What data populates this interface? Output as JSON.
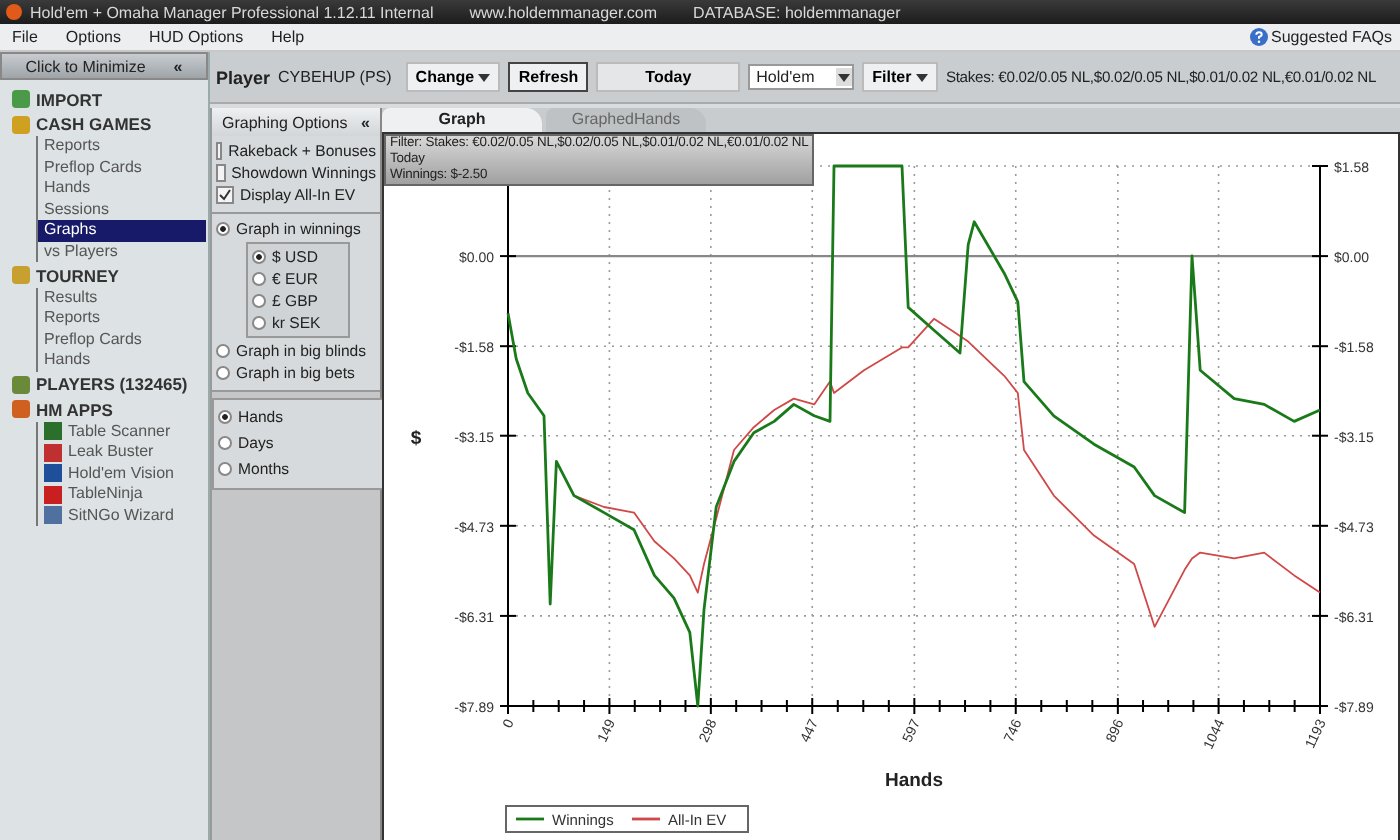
{
  "window": {
    "title": "Hold'em + Omaha Manager Professional 1.12.11 Internal",
    "site": "www.holdemmanager.com",
    "database": "DATABASE: holdemmanager"
  },
  "menu": [
    "File",
    "Options",
    "HUD Options",
    "Help"
  ],
  "help_link": "Suggested FAQs",
  "sidebar": {
    "minimize": "Click to Minimize",
    "minimize_glyph": "«",
    "sections": [
      {
        "label": "IMPORT",
        "kind": "import"
      },
      {
        "label": "CASH GAMES",
        "kind": "cash",
        "children": [
          {
            "label": "Reports",
            "selected": false
          },
          {
            "label": "Preflop Cards",
            "selected": false
          },
          {
            "label": "Hands",
            "selected": false
          },
          {
            "label": "Sessions",
            "selected": false
          },
          {
            "label": "Graphs",
            "selected": true
          },
          {
            "label": "vs Players",
            "selected": false
          }
        ]
      },
      {
        "label": "TOURNEY",
        "kind": "tourney",
        "children": [
          {
            "label": "Results",
            "selected": false
          },
          {
            "label": "Reports",
            "selected": false
          },
          {
            "label": "Preflop Cards",
            "selected": false
          },
          {
            "label": "Hands",
            "selected": false
          }
        ]
      },
      {
        "label": "PLAYERS (132465)",
        "kind": "players"
      },
      {
        "label": "HM APPS",
        "kind": "apps",
        "children": [
          {
            "label": "Table Scanner",
            "selected": false,
            "kind": "scanner"
          },
          {
            "label": "Leak Buster",
            "selected": false,
            "kind": "leak"
          },
          {
            "label": "Hold'em Vision",
            "selected": false,
            "kind": "vision"
          },
          {
            "label": "TableNinja",
            "selected": false,
            "kind": "ninja"
          },
          {
            "label": "SitNGo Wizard",
            "selected": false,
            "kind": "wizard"
          }
        ]
      }
    ]
  },
  "toolbar": {
    "player_label": "Player",
    "player": "CYBEHUP (PS)",
    "change": "Change",
    "refresh": "Refresh",
    "today": "Today",
    "game": "Hold'em",
    "filter": "Filter",
    "stakes": "Stakes: €0.02/0.05 NL,$0.02/0.05 NL,$0.01/0.02 NL,€0.01/0.02 NL"
  },
  "options": {
    "title": "Graphing Options",
    "collapse": "«",
    "checkboxes": [
      {
        "label": "Rakeback + Bonuses",
        "checked": false
      },
      {
        "label": "Showdown Winnings",
        "checked": false
      },
      {
        "label": "Display All-In EV",
        "checked": true
      }
    ],
    "modes": [
      {
        "label": "Graph in winnings",
        "selected": true
      },
      {
        "label": "Graph in big blinds",
        "selected": false
      },
      {
        "label": "Graph in big bets",
        "selected": false
      }
    ],
    "currencies": [
      {
        "label": "$ USD",
        "selected": true
      },
      {
        "label": "€ EUR",
        "selected": false
      },
      {
        "label": "£ GBP",
        "selected": false
      },
      {
        "label": "kr SEK",
        "selected": false
      }
    ],
    "periods": [
      {
        "label": "Hands",
        "selected": true
      },
      {
        "label": "Days",
        "selected": false
      },
      {
        "label": "Months",
        "selected": false
      }
    ]
  },
  "tabs": [
    {
      "label": "Graph",
      "selected": true
    },
    {
      "label": "GraphedHands",
      "selected": false
    }
  ],
  "filter_box": [
    "Filter: Stakes: €0.02/0.05 NL,$0.02/0.05 NL,$0.01/0.02 NL,€0.01/0.02 NL",
    "Today",
    "Winnings: $-2.50"
  ],
  "graph": {
    "chart_data": {
      "type": "line",
      "xlabel": "Hands",
      "ylabel": "$",
      "x": [
        0,
        12,
        29,
        53,
        62,
        71,
        97,
        141,
        185,
        215,
        244,
        267,
        279,
        288,
        306,
        332,
        361,
        391,
        420,
        450,
        473,
        479,
        523,
        579,
        588,
        626,
        664,
        676,
        685,
        729,
        749,
        758,
        802,
        861,
        920,
        950,
        994,
        1005,
        1017,
        1067,
        1111,
        1155,
        1193
      ],
      "series": [
        {
          "name": "Winnings",
          "color": "#1a7a1a",
          "values": [
            -1.0,
            -1.8,
            -2.4,
            -2.8,
            -6.1,
            -3.6,
            -4.2,
            -4.5,
            -4.8,
            -5.6,
            -6.0,
            -6.6,
            -7.89,
            -6.2,
            -4.4,
            -3.6,
            -3.1,
            -2.9,
            -2.6,
            -2.8,
            -2.9,
            1.58,
            1.58,
            1.58,
            -0.9,
            -1.3,
            -1.7,
            0.2,
            0.6,
            -0.3,
            -0.8,
            -2.2,
            -2.8,
            -3.3,
            -3.7,
            -4.2,
            -4.5,
            0.0,
            -2.0,
            -2.5,
            -2.6,
            -2.9,
            -2.7
          ]
        },
        {
          "name": "All-In EV",
          "color": "#d04848",
          "values": [
            null,
            null,
            null,
            null,
            null,
            null,
            -4.2,
            -4.4,
            -4.5,
            -5.0,
            -5.3,
            -5.6,
            -5.9,
            -5.4,
            -4.6,
            -3.4,
            -3.0,
            -2.7,
            -2.5,
            -2.6,
            -2.2,
            -2.4,
            -2.0,
            -1.6,
            -1.6,
            -1.1,
            -1.4,
            -1.5,
            -1.6,
            -2.1,
            -2.4,
            -3.4,
            -4.2,
            -4.9,
            -5.4,
            -6.5,
            -5.5,
            -5.3,
            -5.2,
            -5.3,
            -5.2,
            -5.6,
            -5.9
          ]
        }
      ],
      "grid": true,
      "legend": true,
      "xlim": [
        0,
        1193
      ],
      "ylim": [
        -7.89,
        1.58
      ],
      "xticks": [
        0,
        149,
        298,
        447,
        597,
        746,
        896,
        1044,
        1193
      ],
      "yticks": [
        {
          "value": -7.89,
          "label": "-$7.89"
        },
        {
          "value": -6.31,
          "label": "-$6.31"
        },
        {
          "value": -4.73,
          "label": "-$4.73"
        },
        {
          "value": -3.15,
          "label": "-$3.15"
        },
        {
          "value": -1.58,
          "label": "-$1.58"
        },
        {
          "value": 0,
          "label": "$0.00"
        },
        {
          "value": 1.58,
          "label": "$1.58"
        }
      ]
    }
  }
}
